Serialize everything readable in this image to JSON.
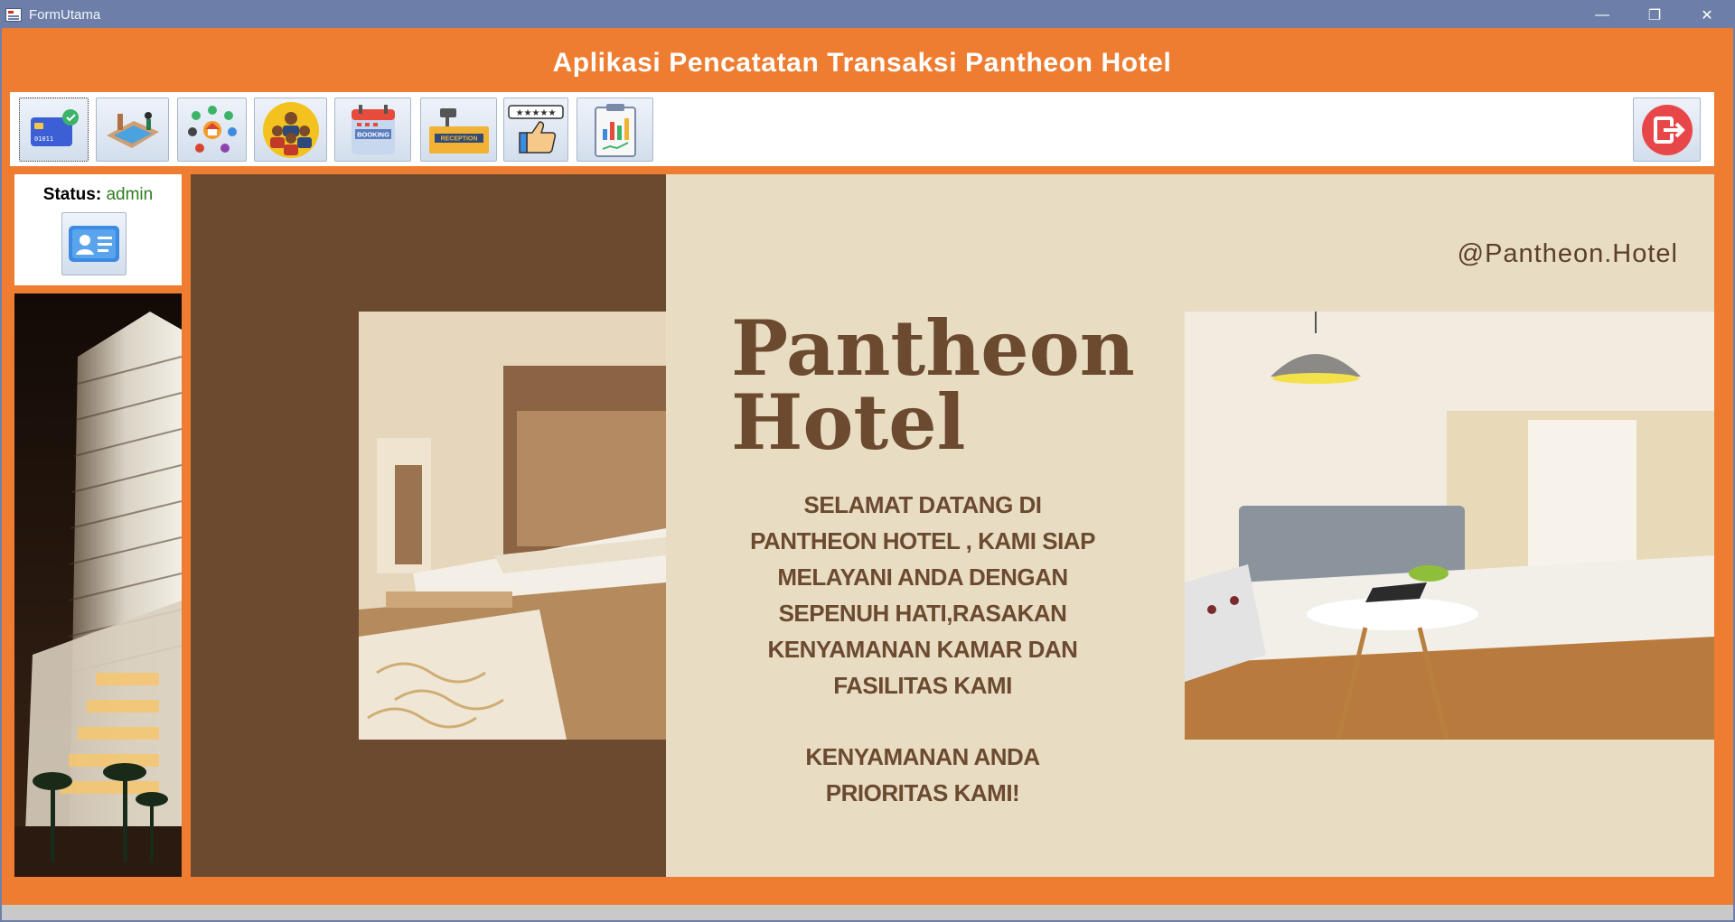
{
  "window": {
    "title": "FormUtama",
    "controls": {
      "minimize": "—",
      "restore": "❐",
      "close": "✕"
    }
  },
  "header": {
    "title": "Aplikasi Pencatatan Transaksi Pantheon Hotel"
  },
  "toolbar": {
    "buttons": [
      {
        "icon": "payment-card-icon"
      },
      {
        "icon": "room-bed-icon"
      },
      {
        "icon": "facility-settings-icon"
      },
      {
        "icon": "employees-group-icon"
      },
      {
        "icon": "booking-calendar-icon",
        "caption": "BOOKING"
      },
      {
        "icon": "reception-desk-icon",
        "caption": "RECEPTION"
      },
      {
        "icon": "rating-thumbs-up-icon"
      },
      {
        "icon": "report-chart-icon"
      }
    ],
    "logout_icon": "logout-icon"
  },
  "sidebar": {
    "status_label": "Status:",
    "status_value": "admin",
    "user_icon": "user-id-card-icon"
  },
  "banner": {
    "handle": "@Pantheon.Hotel",
    "title_line1": "Pantheon",
    "title_line2": "Hotel",
    "welcome_lines": [
      "SELAMAT DATANG DI",
      "PANTHEON HOTEL , KAMI SIAP",
      "MELAYANI ANDA DENGAN",
      "SEPENUH HATI,RASAKAN",
      "KENYAMANAN KAMAR DAN",
      "FASILITAS KAMI"
    ],
    "tagline_lines": [
      "KENYAMANAN ANDA",
      "PRIORITAS KAMI!"
    ]
  },
  "colors": {
    "frame_orange": "#ee7d31",
    "titlebar": "#6d7fa8",
    "banner_brown": "#6b4a30",
    "banner_cream": "#e8dcc3",
    "status_value": "#2e7d1e"
  }
}
